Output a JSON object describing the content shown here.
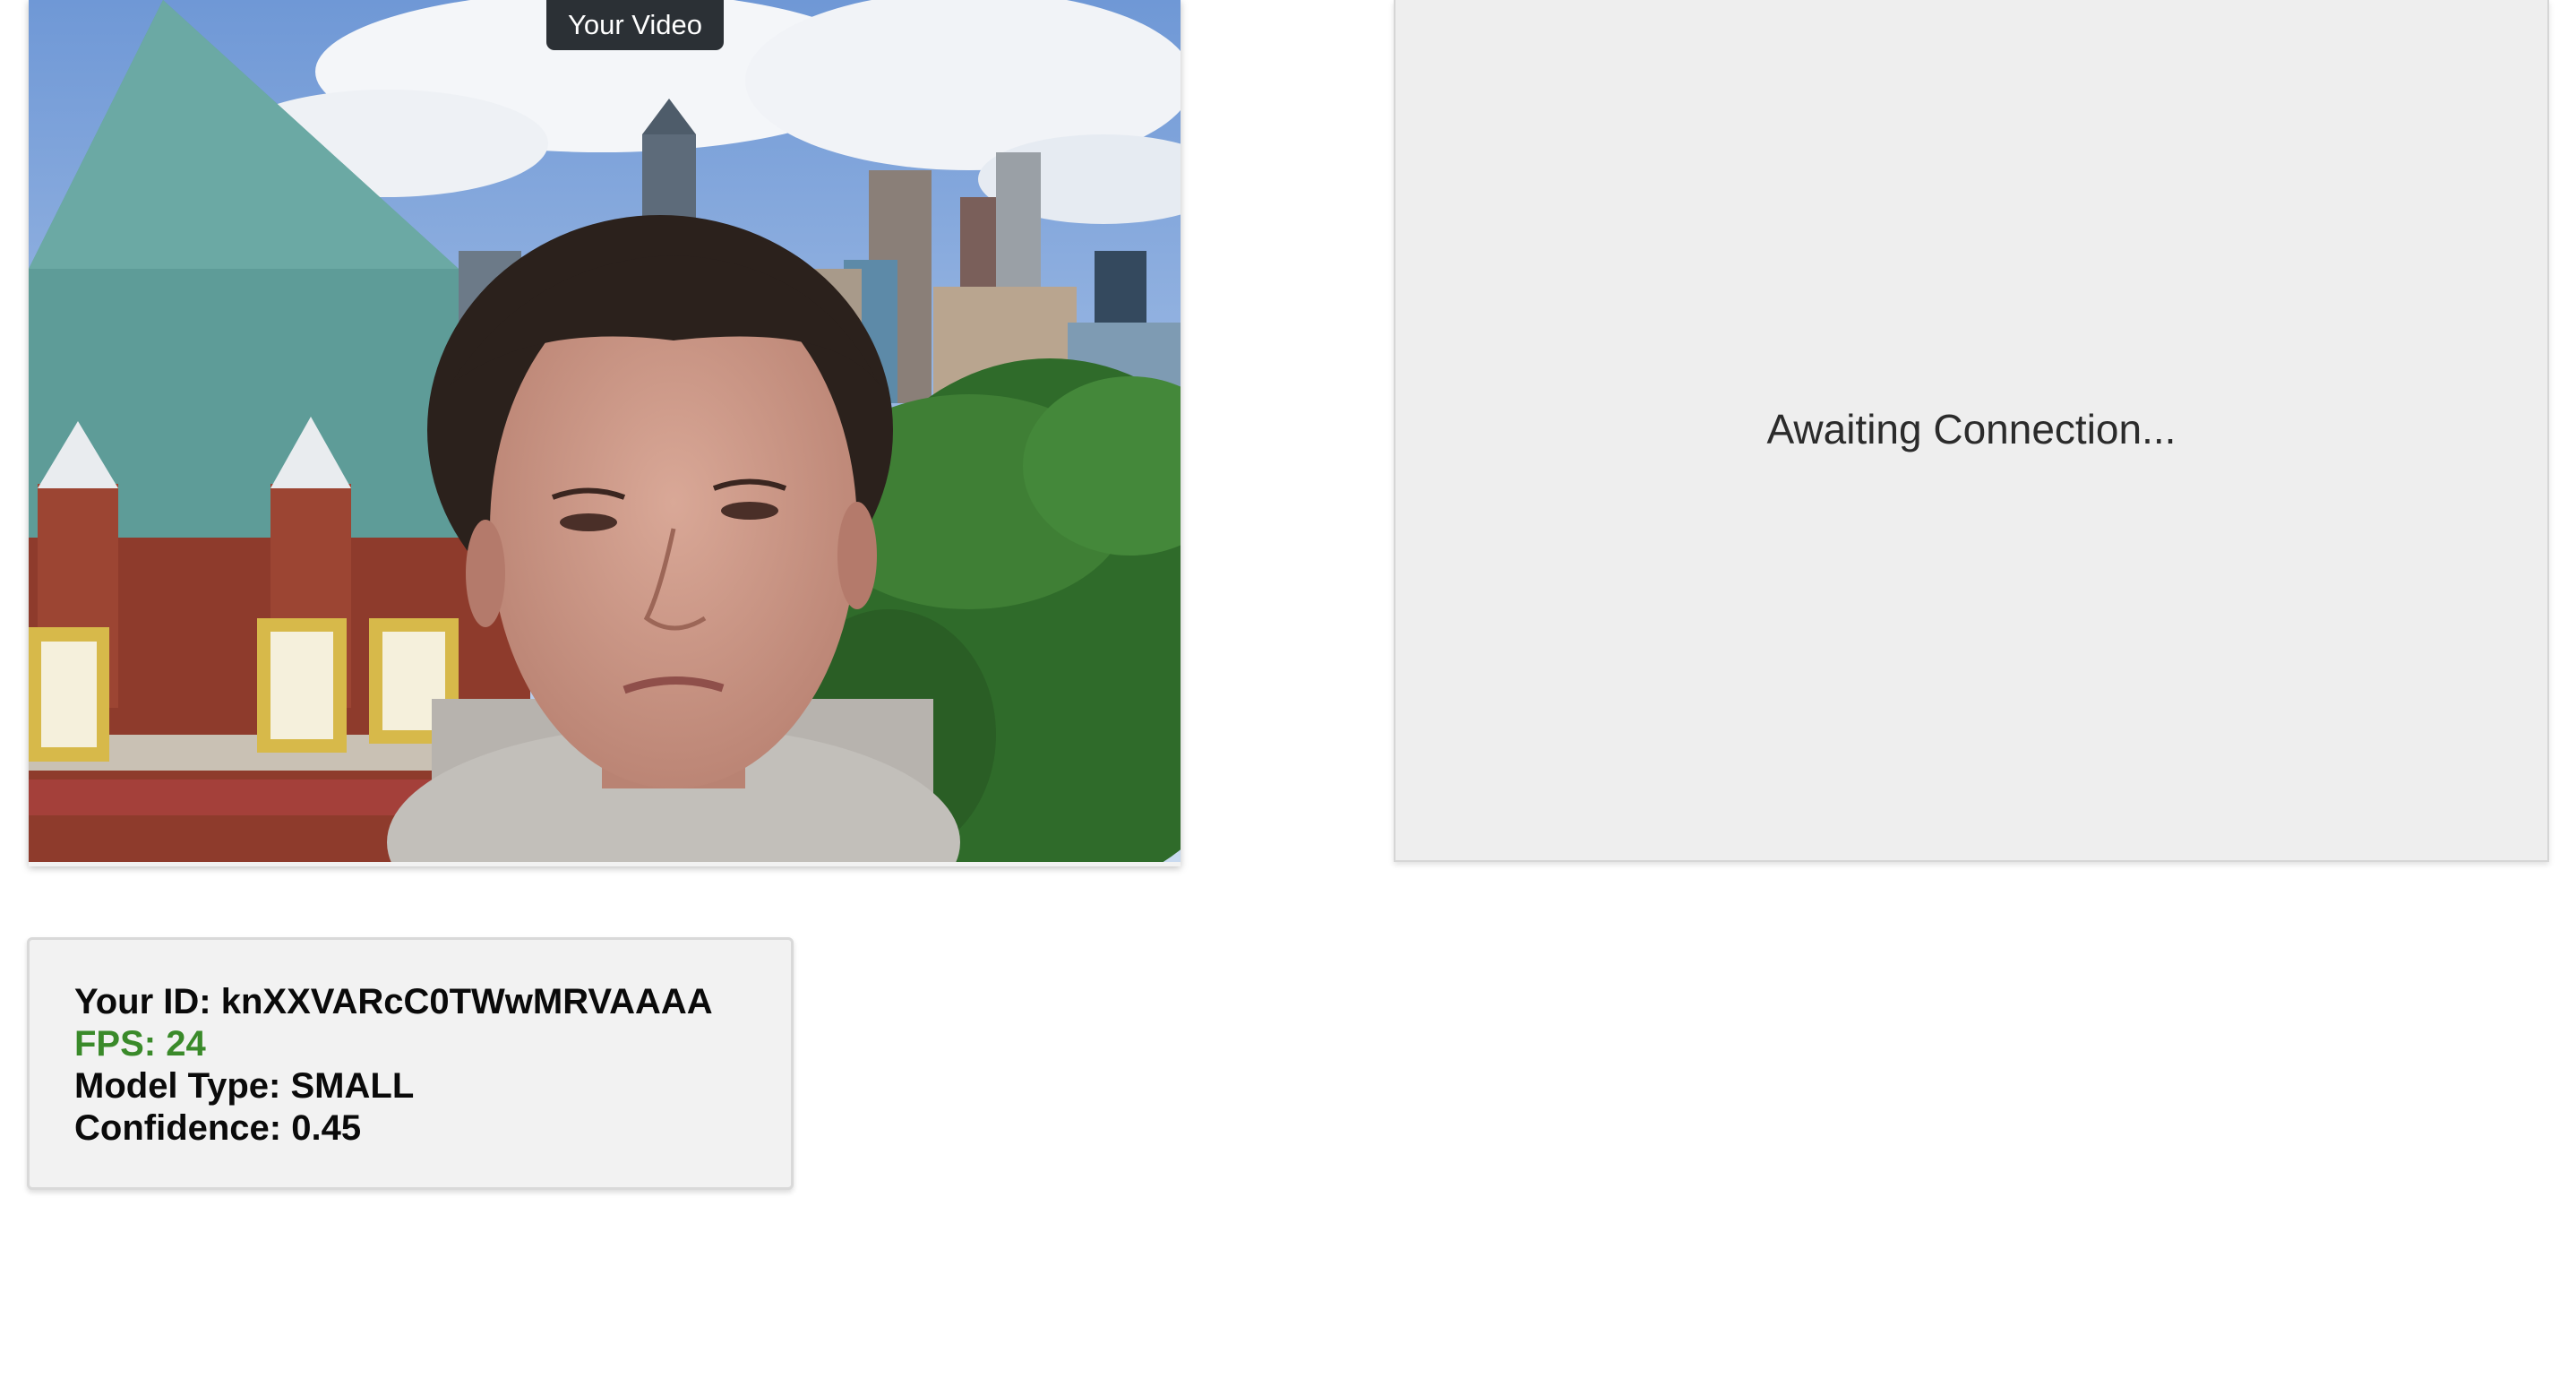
{
  "local_video": {
    "label": "Your Video"
  },
  "remote_video": {
    "status": "Awaiting Connection..."
  },
  "stats": {
    "id_label": "Your ID:",
    "id_value": "knXXVARcC0TWwMRVAAAA",
    "fps_label": "FPS:",
    "fps_value": "24",
    "model_label": "Model Type:",
    "model_value": "SMALL",
    "confidence_label": "Confidence:",
    "confidence_value": "0.45"
  },
  "colors": {
    "fps_green": "#3a8a2a",
    "remote_background": "#eeeeee",
    "panel_background": "#f2f2f2",
    "label_background": "#2b3035"
  }
}
